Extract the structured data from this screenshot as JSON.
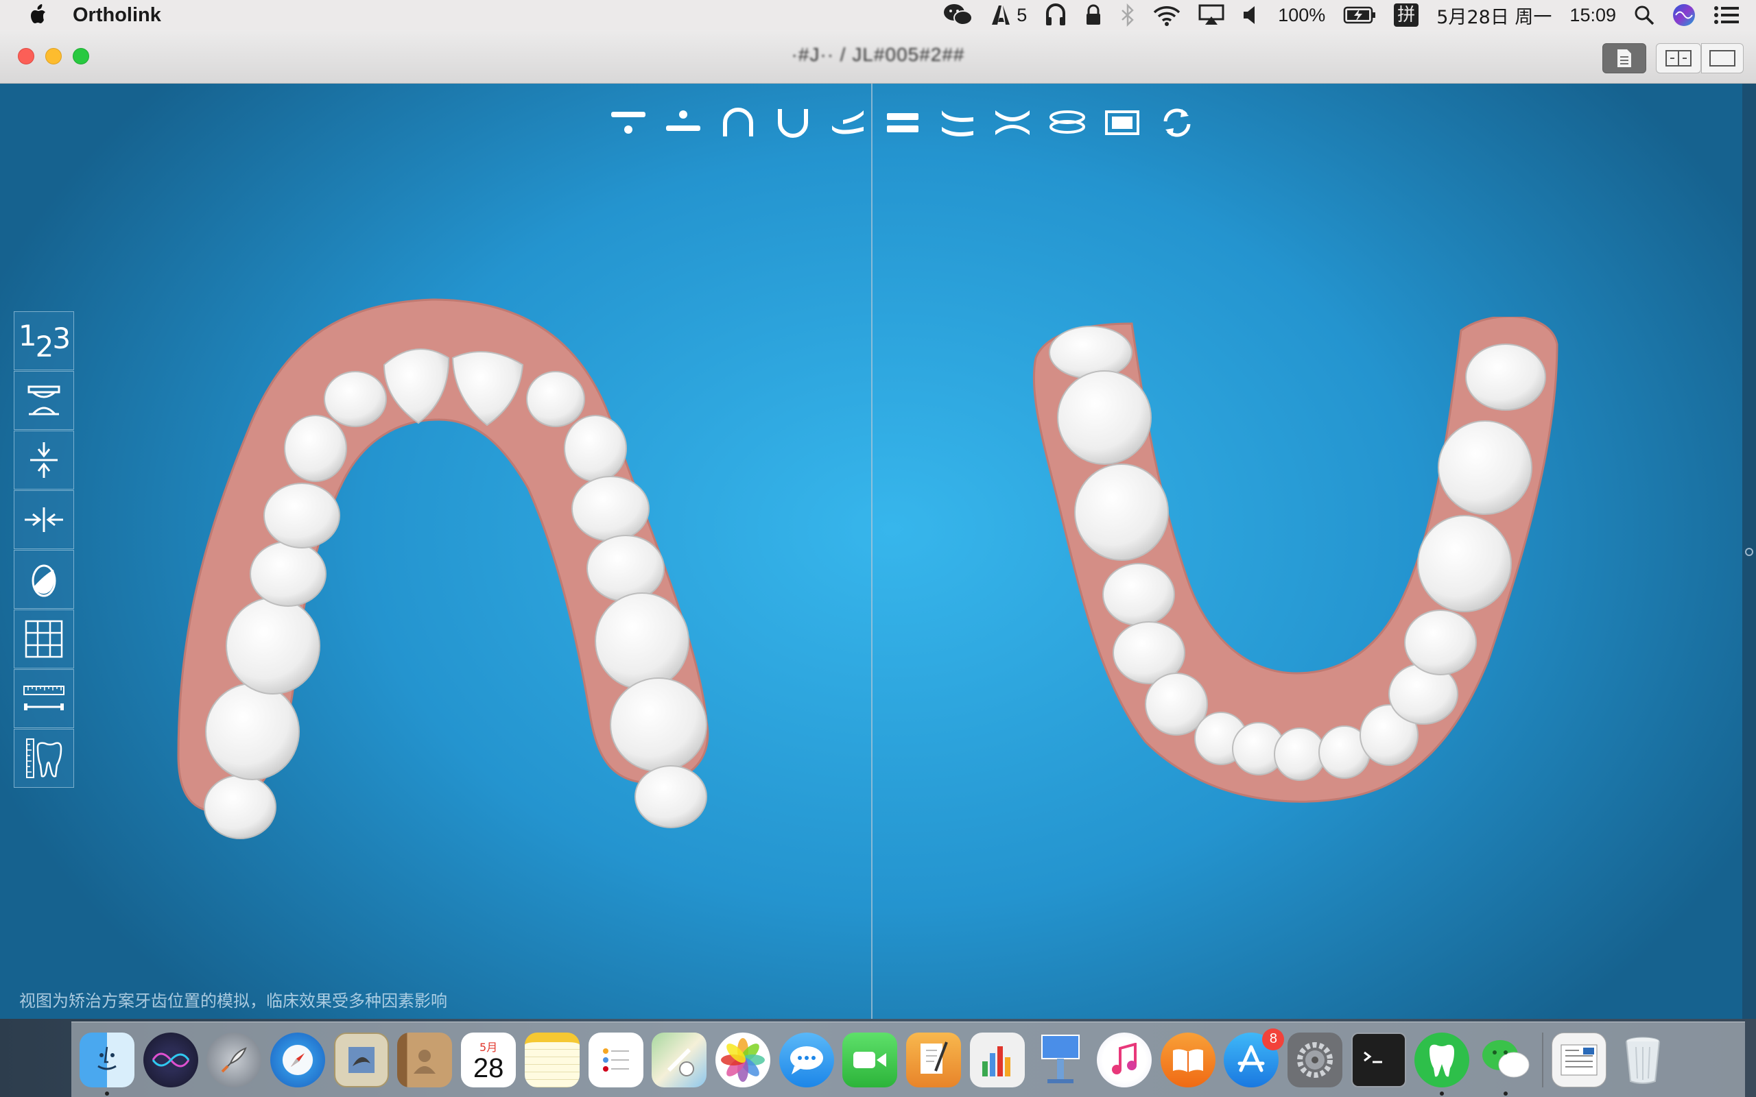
{
  "menubar": {
    "app_name": "Ortholink",
    "wechat_count": "5",
    "battery": "100%",
    "input_method": "拼",
    "date": "5月28日 周一",
    "time": "15:09"
  },
  "window": {
    "title": "·#J·· / JL#005#2##"
  },
  "viewport": {
    "disclaimer": "视图为矫治方案牙齿位置的模拟，临床效果受多种因素影响",
    "left_tool_label": "123"
  },
  "top_toolbar": [
    "front-view",
    "back-view",
    "upper-arch",
    "lower-arch",
    "left-view",
    "occlusion",
    "right-view",
    "open-view",
    "bite-view",
    "frame-view",
    "reset-view"
  ],
  "left_toolbar": [
    "tooth-numbering",
    "attachment",
    "compress",
    "ipr-gap",
    "crown-shape",
    "grid",
    "ruler",
    "tooth-measure"
  ],
  "dock": {
    "calendar_month": "5月",
    "calendar_day": "28",
    "appstore_badge": "8"
  },
  "colors": {
    "gum": "#d48e86",
    "tooth": "#f4f4f4",
    "bg_center": "#37b6ec",
    "bg_edge": "#16628f"
  }
}
